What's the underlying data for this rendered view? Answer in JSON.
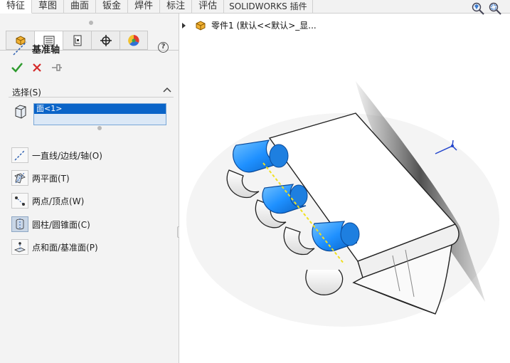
{
  "tabs": [
    "特征",
    "草图",
    "曲面",
    "钣金",
    "焊件",
    "标注",
    "评估",
    "SOLIDWORKS 插件"
  ],
  "pm_tabs": [
    "feature-manager-icon",
    "property-manager-icon",
    "configuration-manager-icon",
    "dimxpert-icon",
    "display-manager-icon"
  ],
  "feature": {
    "title": "基准轴",
    "help": "?"
  },
  "selection": {
    "header": "选择(S)",
    "selected_item": "面<1>",
    "options": [
      {
        "label": "一直线/边线/轴(O)",
        "icon": "line-edge-axis-icon"
      },
      {
        "label": "两平面(T)",
        "icon": "two-planes-icon"
      },
      {
        "label": "两点/顶点(W)",
        "icon": "two-points-icon"
      },
      {
        "label": "圆柱/圆锥面(C)",
        "icon": "cylinder-cone-icon",
        "active": true
      },
      {
        "label": "点和面/基准面(P)",
        "icon": "point-plane-icon"
      }
    ]
  },
  "tree": {
    "part_label": "零件1  (默认<<默认>_显..."
  },
  "colors": {
    "accent": "#0a64c8",
    "highlight_face": "#1e90ff",
    "axis": "#f0e020",
    "check": "#2e9b2e",
    "cancel": "#d42a2a"
  }
}
